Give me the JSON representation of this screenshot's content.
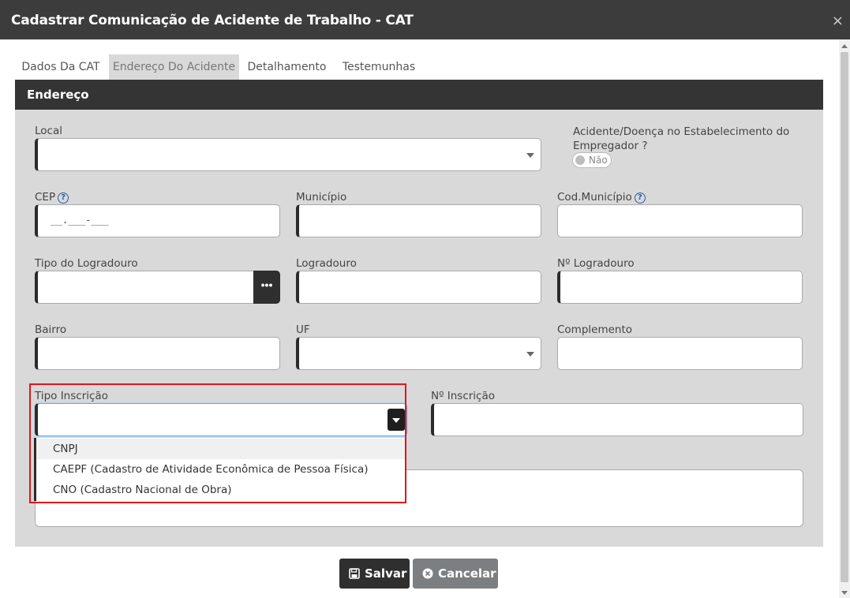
{
  "window": {
    "title": "Cadastrar Comunicação de Acidente de Trabalho - CAT",
    "close_glyph": "×"
  },
  "tabs": [
    {
      "label": "Dados Da CAT",
      "active": false
    },
    {
      "label": "Endereço Do Acidente",
      "active": true
    },
    {
      "label": "Detalhamento",
      "active": false
    },
    {
      "label": "Testemunhas",
      "active": false
    }
  ],
  "section": {
    "title": "Endereço"
  },
  "form": {
    "local": {
      "label": "Local",
      "value": ""
    },
    "estabelecimento": {
      "label": "Acidente/Doença no Estabelecimento do Empregador ?",
      "toggle_text": "Não",
      "checked": false
    },
    "cep": {
      "label": "CEP",
      "mask": "__.___-___",
      "help_glyph": "?"
    },
    "municipio": {
      "label": "Município",
      "value": ""
    },
    "cod_municipio": {
      "label": "Cod.Município",
      "help_glyph": "?",
      "value": ""
    },
    "tipo_logradouro": {
      "label": "Tipo do Logradouro",
      "value": "",
      "button_glyph": "•••"
    },
    "logradouro": {
      "label": "Logradouro",
      "value": ""
    },
    "num_logradouro": {
      "label": "Nº Logradouro",
      "value": ""
    },
    "bairro": {
      "label": "Bairro",
      "value": ""
    },
    "uf": {
      "label": "UF",
      "value": ""
    },
    "complemento": {
      "label": "Complemento",
      "value": ""
    },
    "tipo_inscricao": {
      "label": "Tipo Inscrição",
      "value": "",
      "options": [
        "CNPJ",
        "CAEPF (Cadastro de Atividade Econômica de Pessoa Física)",
        "CNO (Cadastro Nacional de Obra)"
      ]
    },
    "num_inscricao": {
      "label": "Nº Inscrição",
      "value": ""
    }
  },
  "buttons": {
    "save": "Salvar",
    "cancel": "Cancelar"
  },
  "colors": {
    "header": "#3c3c3c",
    "panel": "#d9d9d9",
    "highlight_box": "#e0151b"
  }
}
